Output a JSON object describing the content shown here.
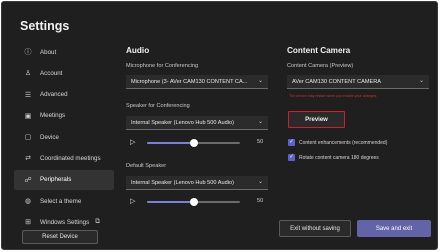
{
  "title": "Settings",
  "sidebar": {
    "items": [
      {
        "label": "About",
        "icon": "info-icon",
        "glyph": "ⓘ"
      },
      {
        "label": "Account",
        "icon": "account-icon",
        "glyph": "♙"
      },
      {
        "label": "Advanced",
        "icon": "advanced-icon",
        "glyph": "☰"
      },
      {
        "label": "Meetings",
        "icon": "meetings-icon",
        "glyph": "▣"
      },
      {
        "label": "Device",
        "icon": "device-icon",
        "glyph": "▢"
      },
      {
        "label": "Coordinated meetings",
        "icon": "coordinated-icon",
        "glyph": "⇄"
      },
      {
        "label": "Peripherals",
        "icon": "peripherals-icon",
        "glyph": "☍",
        "active": true
      },
      {
        "label": "Select a theme",
        "icon": "theme-icon",
        "glyph": "◍"
      },
      {
        "label": "Windows Settings",
        "icon": "windows-icon",
        "glyph": "⊞",
        "external": "⧉"
      }
    ],
    "reset_label": "Reset Device"
  },
  "audio": {
    "heading": "Audio",
    "microphone": {
      "label": "Microphone for Conferencing",
      "value": "Microphone (3- AVer CAM130 CONTENT CA..."
    },
    "speaker": {
      "label": "Speaker for Conferencing",
      "value": "Internal Speaker (Lenovo Hub 500 Audio)",
      "volume": "50"
    },
    "default_speaker": {
      "label": "Default Speaker",
      "value": "Internal Speaker (Lenovo Hub 500 Audio)",
      "volume": "50"
    },
    "volume_fraction": 0.5
  },
  "content_camera": {
    "heading": "Content Camera",
    "label": "Content Camera (Preview)",
    "value": "AVer CAM130 CONTENT CAMERA",
    "warning": "The device may restart when you enable your changes.",
    "preview_label": "Preview",
    "options": [
      {
        "label": "Content enhancements (recommended)",
        "checked": true
      },
      {
        "label": "Rotate content camera 180 degrees",
        "checked": true
      }
    ]
  },
  "footer": {
    "exit_label": "Exit without saving",
    "save_label": "Save and exit"
  },
  "colors": {
    "accent": "#6264a7",
    "highlight": "#d11f2a",
    "background": "#1f1f1f"
  }
}
